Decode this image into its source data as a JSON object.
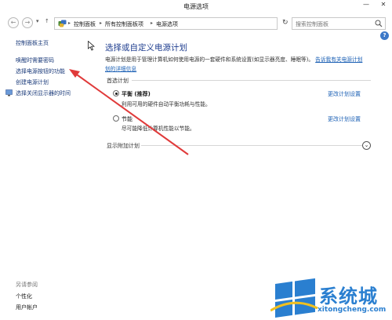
{
  "window": {
    "title": "电源选项",
    "minimize_glyph": "—",
    "close_glyph": "✕"
  },
  "navbar": {
    "back_glyph": "←",
    "forward_glyph": "→",
    "recent_glyph": "▾",
    "up_glyph": "↑",
    "refresh_glyph": "↻",
    "breadcrumbs": [
      "控制面板",
      "所有控制面板项",
      "电源选项"
    ],
    "separator_glyph": "▸",
    "search_placeholder": "搜索控制面板"
  },
  "help_glyph": "?",
  "sidebar": {
    "home_label": "控制面板主页",
    "items": [
      "唤醒时需要密码",
      "选择电源按钮的功能",
      "创建电源计划",
      "选择关闭显示器的时间"
    ],
    "see_also_label": "另请参阅",
    "see_also_items": [
      "个性化",
      "用户帐户"
    ]
  },
  "main": {
    "title": "选择或自定义电源计划",
    "description_line1": "电源计划是用于管理计算机如何使用电源的一套硬件和系统设置(如显示器亮度、睡眠等)。",
    "description_link_line1": "告诉我有关电源计划",
    "description_link_line2": "划的详细信息",
    "preferred_plans_label": "首选计划",
    "plans": [
      {
        "name": "平衡 (推荐)",
        "description": "利用可用的硬件自动平衡功耗与性能。",
        "link": "更改计划设置",
        "selected": true
      },
      {
        "name": "节能",
        "description": "尽可能降低计算机性能以节能。",
        "link": "更改计划设置",
        "selected": false
      }
    ],
    "additional_plans_label": "显示附加计划",
    "expand_glyph": "⌄"
  },
  "watermark": {
    "title": "系统城",
    "url": "xitongcheng.com"
  },
  "colors": {
    "link": "#1a5fb4",
    "title": "#1e3d8f",
    "annotation_arrow": "#e03a3a",
    "watermark": "#2a7fd0"
  }
}
